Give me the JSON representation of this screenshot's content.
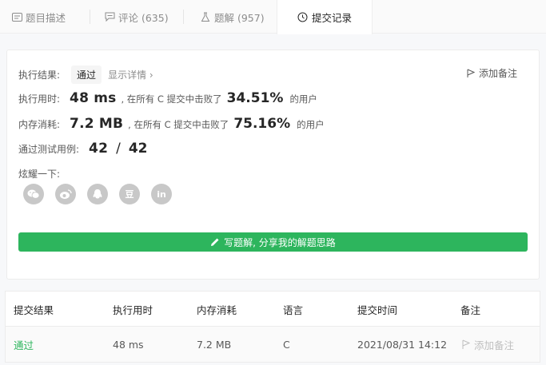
{
  "tabs": [
    {
      "label": "题目描述",
      "icon": "description-icon"
    },
    {
      "label": "评论 (635)",
      "icon": "comment-icon"
    },
    {
      "label": "题解 (957)",
      "icon": "flask-icon"
    },
    {
      "label": "提交记录",
      "icon": "clock-icon"
    }
  ],
  "result": {
    "label": "执行结果:",
    "status": "通过",
    "detail_link": "显示详情 ›",
    "add_note": "添加备注"
  },
  "runtime": {
    "label": "执行用时:",
    "value": "48 ms",
    "mid": ", 在所有 C 提交中击败了",
    "percent": "34.51%",
    "tail": "的用户"
  },
  "memory": {
    "label": "内存消耗:",
    "value": "7.2 MB",
    "mid": ", 在所有 C 提交中击败了",
    "percent": "75.16%",
    "tail": "的用户"
  },
  "tests": {
    "label": "通过测试用例:",
    "passed": "42",
    "slash": "/",
    "total": "42"
  },
  "share": {
    "label": "炫耀一下:",
    "icons": [
      "wechat-icon",
      "weibo-icon",
      "qq-icon",
      "douban-icon",
      "linkedin-icon"
    ],
    "douban_glyph": "豆",
    "linkedin_glyph": "in"
  },
  "write_solution": "写题解, 分享我的解题思路",
  "submissions": {
    "headers": [
      "提交结果",
      "执行用时",
      "内存消耗",
      "语言",
      "提交时间",
      "备注"
    ],
    "rows": [
      {
        "status": "通过",
        "runtime": "48 ms",
        "memory": "7.2 MB",
        "language": "C",
        "time": "2021/08/31 14:12",
        "note": "添加备注"
      }
    ]
  },
  "colors": {
    "accent_green": "#2db55d",
    "icon_gray": "#c8c8c8"
  }
}
